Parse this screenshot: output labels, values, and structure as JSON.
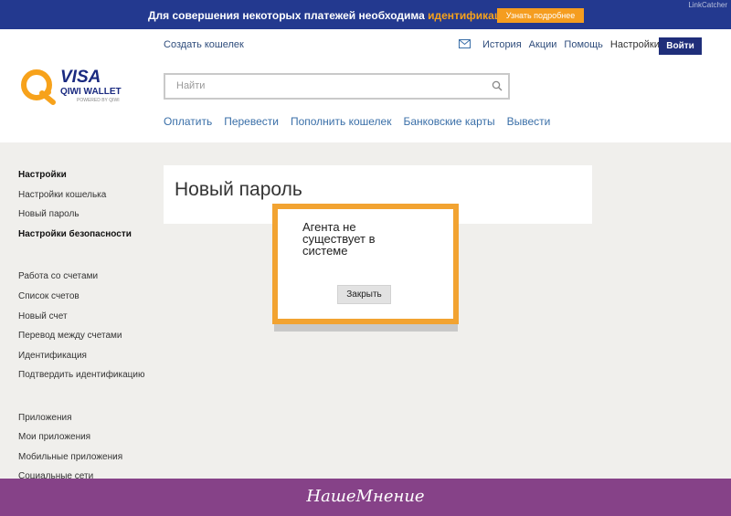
{
  "banner": {
    "text": "Для совершения некоторых платежей необходима ",
    "link": "идентификация",
    "button": "Узнать подробнее",
    "watermark": "LinkCatcher",
    "bg_color": "#23398f",
    "accent_color": "#f59d1f"
  },
  "logo": {
    "visa": "VISA",
    "qiwi": "QIWI WALLET",
    "powered": "POWERED BY QIWI"
  },
  "header": {
    "create_wallet": "Создать кошелек",
    "mail_icon": "mail-icon",
    "top_links": [
      "История",
      "Акции",
      "Помощь",
      "Настройки"
    ],
    "login": "Войти"
  },
  "search": {
    "placeholder": "Найти",
    "icon": "search-icon"
  },
  "main_nav": [
    "Оплатить",
    "Перевести",
    "Пополнить кошелек",
    "Банковские карты",
    "Вывести"
  ],
  "sidebar": {
    "groups": [
      [
        "Настройки",
        "Настройки кошелька",
        "Новый пароль",
        "Настройки безопасности"
      ],
      [
        "Работа со счетами",
        "Список счетов",
        "Новый счет",
        "Перевод между счетами",
        "Идентификация",
        "Подтвердить идентификацию"
      ],
      [
        "Приложения",
        "Мои приложения",
        "Мобильные приложения",
        "Социальные сети"
      ]
    ]
  },
  "card": {
    "title": "Новый пароль"
  },
  "modal": {
    "message": "Агента не существует в системе",
    "close": "Закрыть",
    "border_color": "#f2a331"
  },
  "footer": {
    "text": "НашеМнение",
    "bg_color": "#864288"
  }
}
